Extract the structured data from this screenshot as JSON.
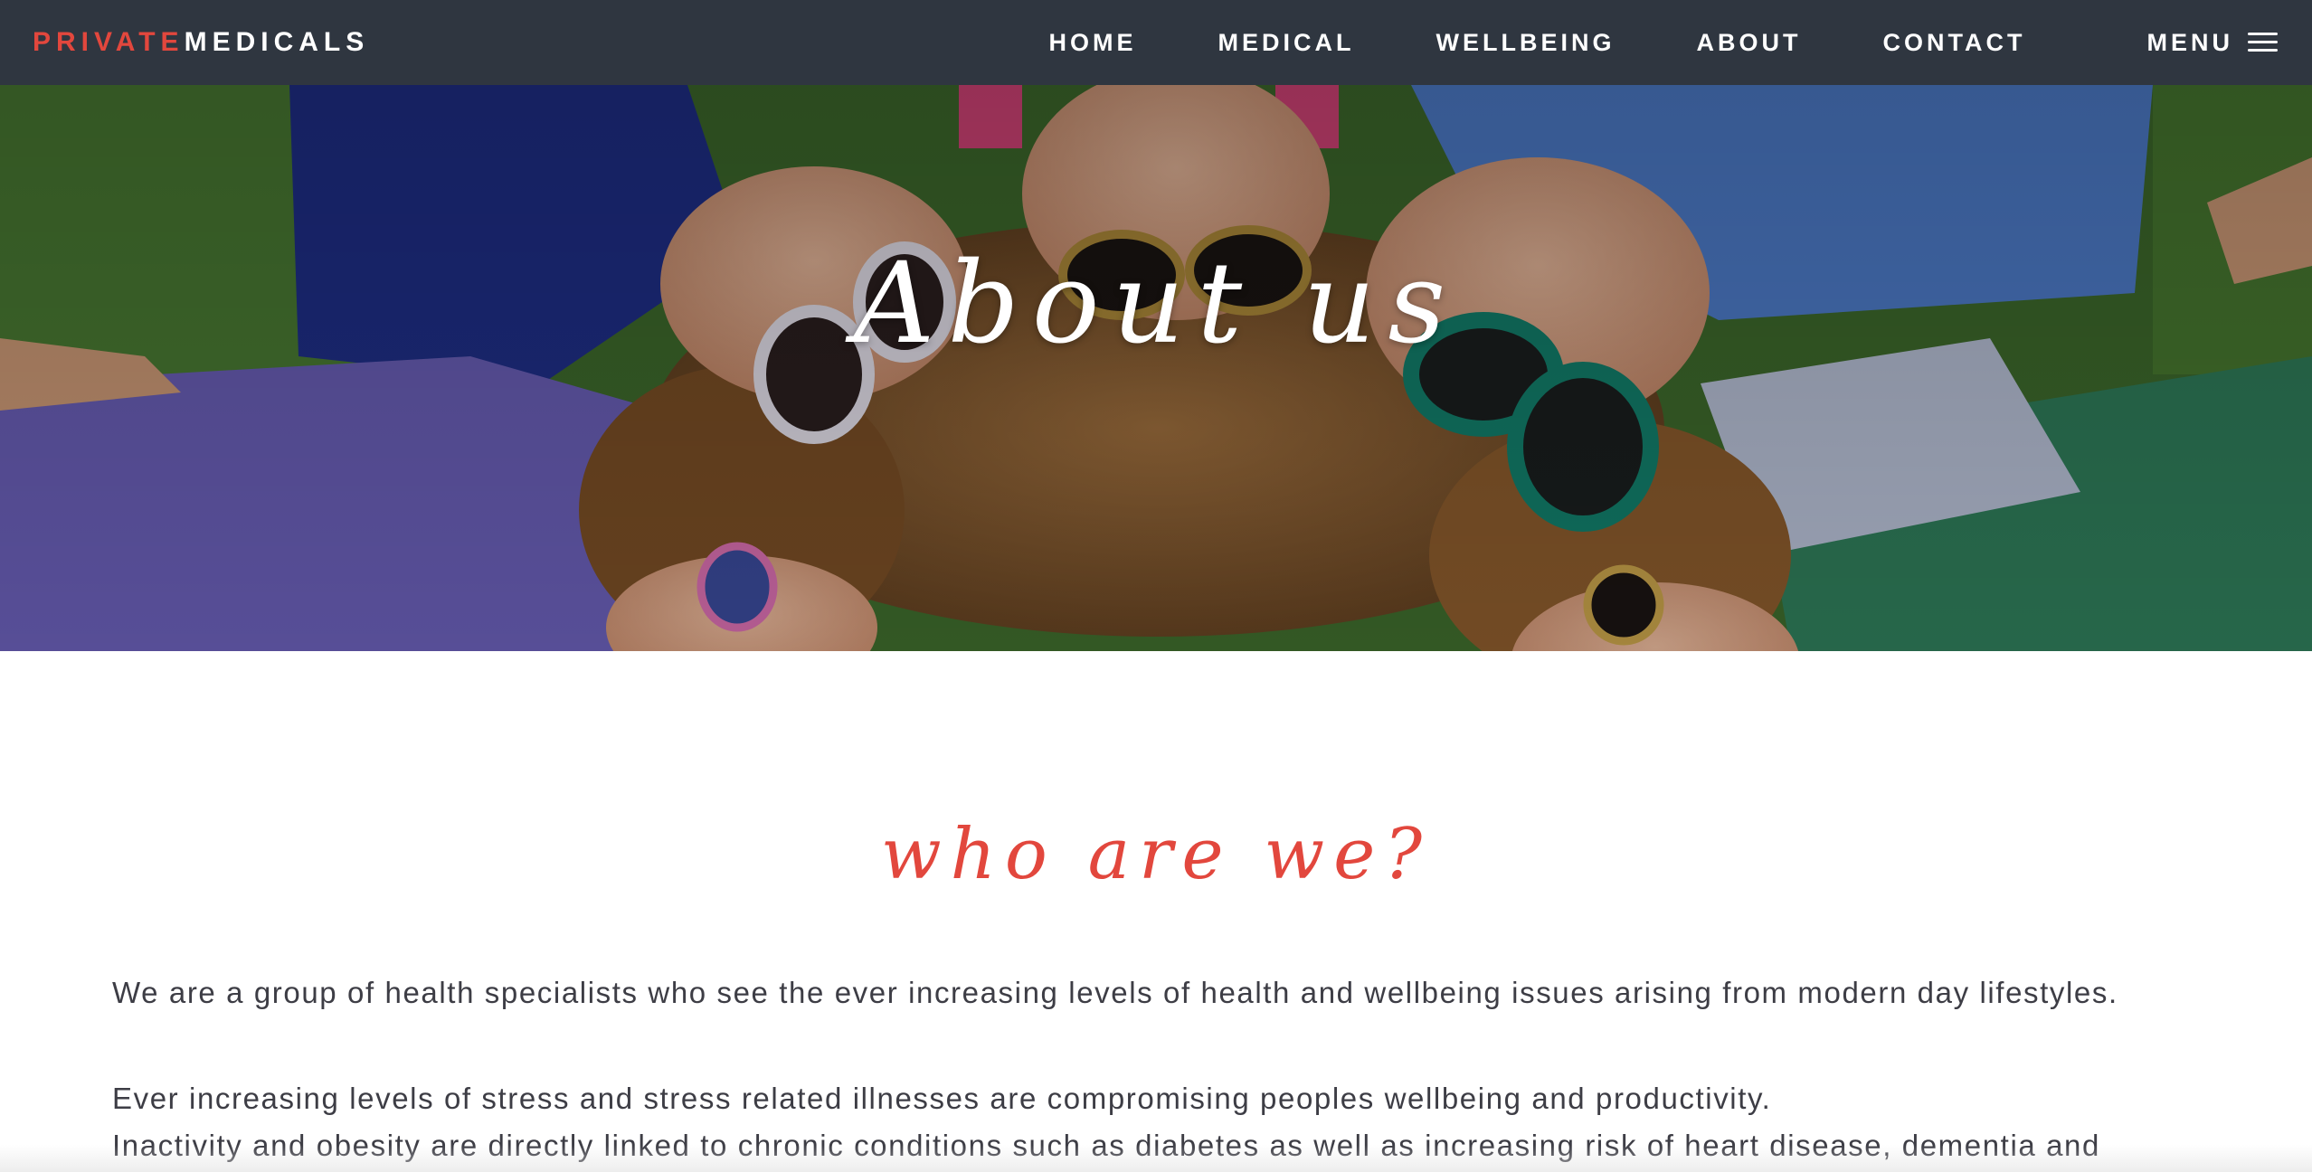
{
  "brand": {
    "prefix": "PRIVATE",
    "suffix": "MEDICALS",
    "accent_color": "#e2473d",
    "nav_bg_color": "#2f3640"
  },
  "nav": {
    "links": [
      {
        "label": "HOME"
      },
      {
        "label": "MEDICAL"
      },
      {
        "label": "WELLBEING"
      },
      {
        "label": "ABOUT"
      },
      {
        "label": "CONTACT"
      }
    ],
    "menu_label": "MENU",
    "menu_icon": "hamburger-icon"
  },
  "hero": {
    "title": "About us",
    "image": "children-lying-on-grass-with-sunglasses"
  },
  "main": {
    "heading": "who are we?",
    "paragraphs": [
      "We are a group of health specialists who see the ever increasing levels of health and wellbeing issues arising from modern day lifestyles.",
      "Ever increasing levels of stress and stress related illnesses are compromising peoples wellbeing and productivity.",
      "Inactivity and obesity are directly linked to chronic conditions such as diabetes as well as increasing risk of heart disease, dementia and"
    ],
    "text_color": "#3d3d45"
  }
}
